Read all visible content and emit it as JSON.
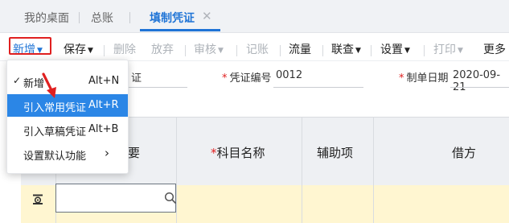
{
  "tabs": [
    {
      "label": "我的桌面"
    },
    {
      "label": "总账"
    },
    {
      "label": "填制凭证"
    }
  ],
  "tab_close": "✕",
  "toolbar": {
    "new": "新增",
    "save": "保存",
    "delete": "删除",
    "discard": "放弃",
    "audit": "审核",
    "post": "记账",
    "cashflow": "流量",
    "query": "联查",
    "settings": "设置",
    "print": "打印",
    "more": "更多"
  },
  "caret": "▼",
  "form": {
    "voucher_word_suffix": "证",
    "voucher_no_label": "凭证编号",
    "voucher_no_value": "0012",
    "date_label": "制单日期",
    "date_value": "2020-09-21",
    "required_mark": "*"
  },
  "table": {
    "headers": [
      "要",
      "科目名称",
      "辅助项",
      "借方"
    ],
    "required_mark": "*"
  },
  "menu": {
    "items": [
      {
        "label": "新增",
        "shortcut": "Alt+N",
        "checked": true,
        "check": "✓"
      },
      {
        "label": "引入常用凭证",
        "shortcut": "Alt+R",
        "highlighted": true
      },
      {
        "label": "引入草稿凭证",
        "shortcut": "Alt+B"
      },
      {
        "label": "设置默认功能",
        "arrow": "›"
      }
    ]
  },
  "colors": {
    "accent": "#1f74d6",
    "highlight": "#2b86e6",
    "annotation_red": "#e02020",
    "row_yellow": "#fff6d1"
  }
}
